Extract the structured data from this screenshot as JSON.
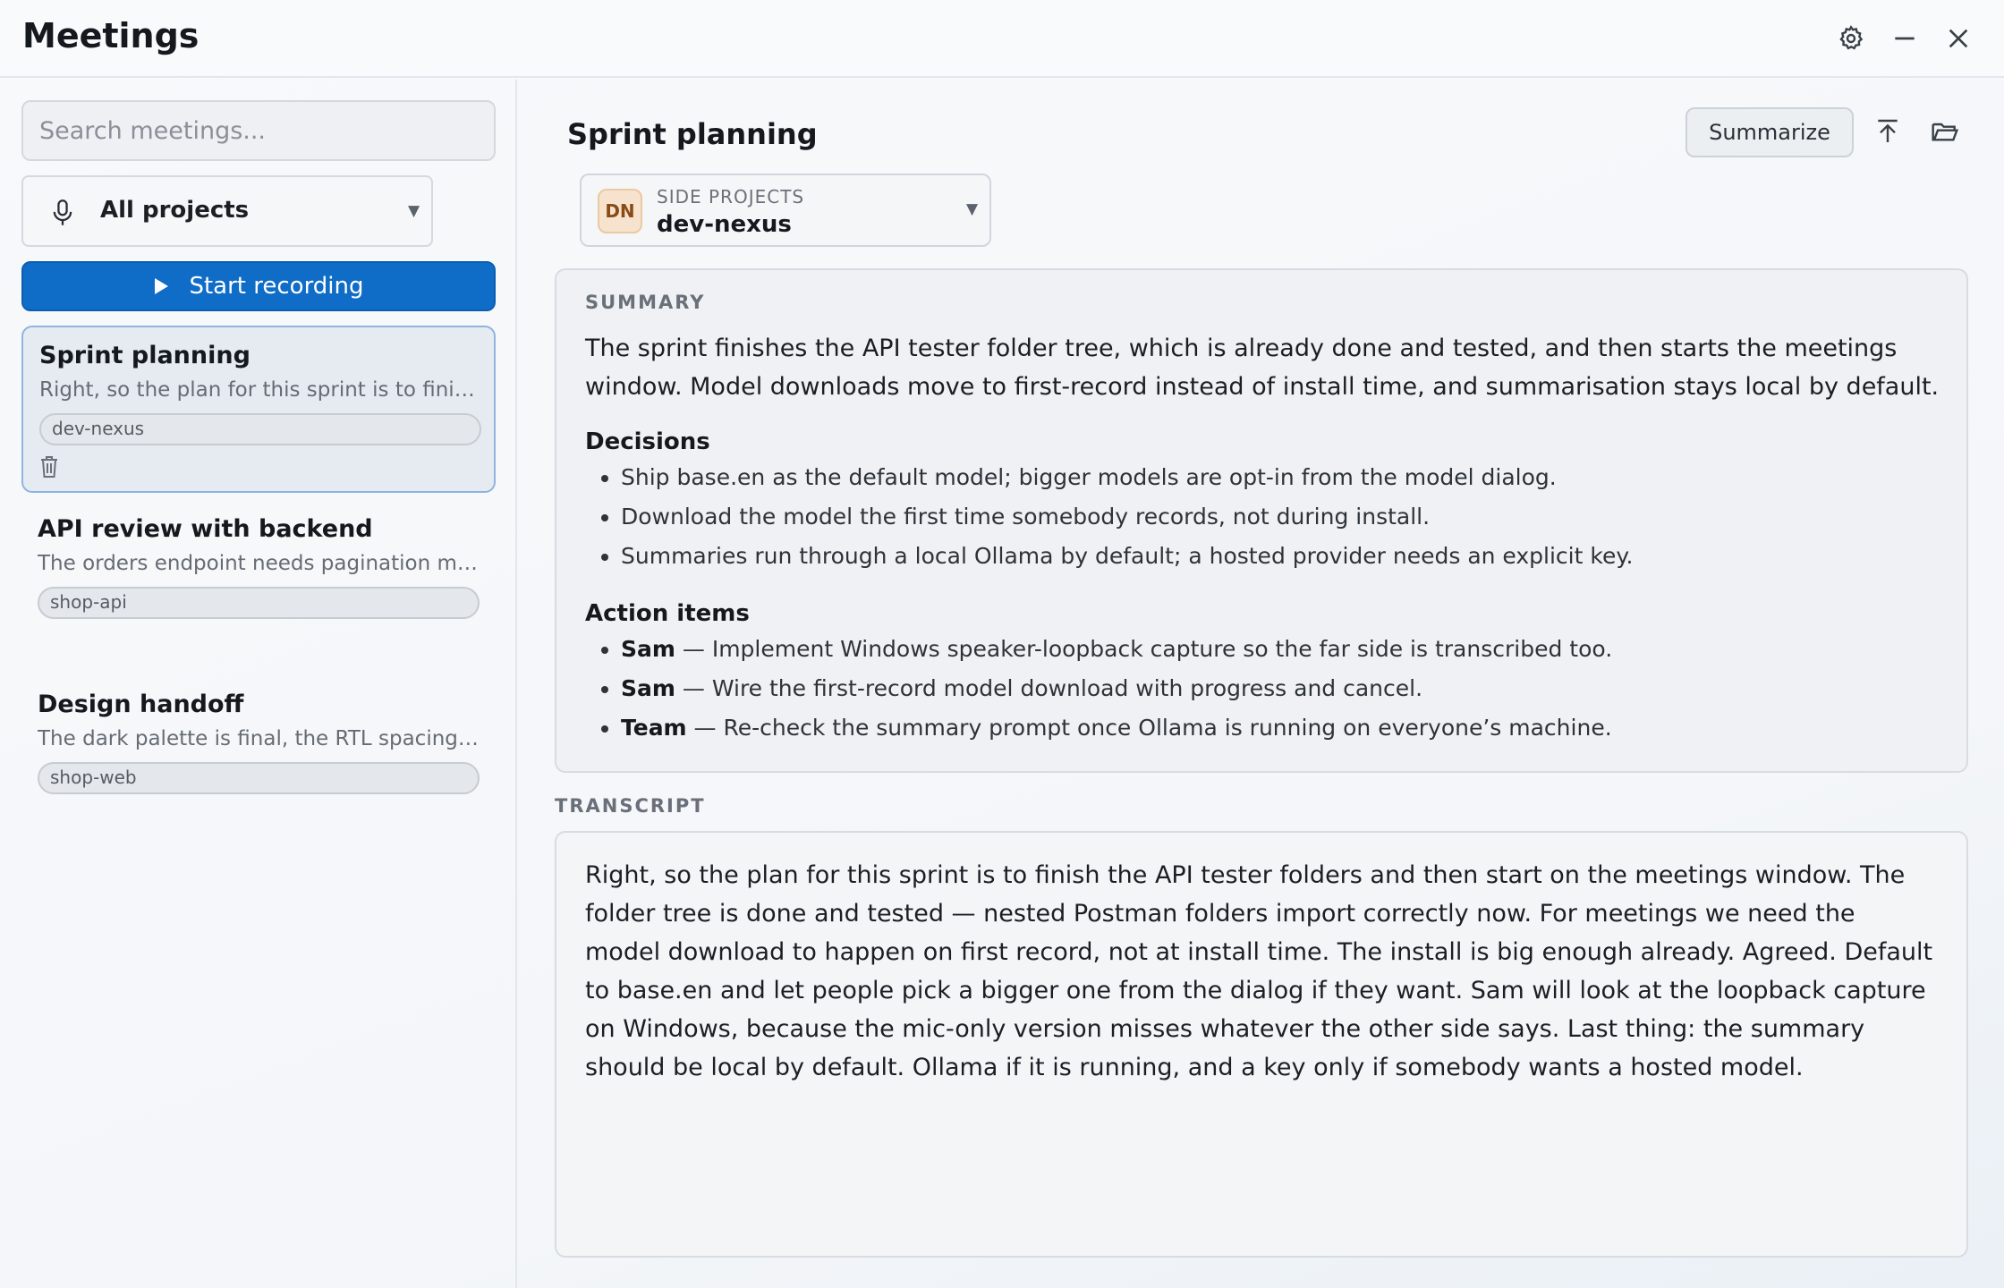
{
  "app": {
    "title": "Meetings"
  },
  "window_controls": [
    "gear-icon",
    "minimize-icon",
    "close-icon"
  ],
  "sidebar": {
    "search_placeholder": "Search meetings...",
    "project_filter": {
      "icon": "microphone-icon",
      "value": "All projects"
    },
    "record_button": {
      "icon": "play-icon",
      "label": "Start recording"
    },
    "meetings": [
      {
        "title": "Sprint planning",
        "snippet": "Right, so the plan for this sprint is to finish...",
        "tag": "dev-nexus",
        "selected": true
      },
      {
        "title": "API review with backend",
        "snippet": "The orders endpoint needs pagination met...",
        "tag": "shop-api",
        "selected": false
      },
      {
        "title": "Design handoff",
        "snippet": "The dark palette is final, the RTL spacing s...",
        "tag": "shop-web",
        "selected": false
      }
    ]
  },
  "main": {
    "title": "Sprint planning",
    "summarize_label": "Summarize",
    "project": {
      "initials": "DN",
      "group": "SIDE PROJECTS",
      "name": "dev-nexus"
    },
    "summary": {
      "label": "SUMMARY",
      "text": "The sprint finishes the API tester folder tree, which is already done and tested, and then starts the meetings window. Model downloads move to first-record instead of install time, and summarisation stays local by default.",
      "decisions_label": "Decisions",
      "decisions": [
        "Ship base.en as the default model; bigger models are opt-in from the model dialog.",
        "Download the model the first time somebody records, not during install.",
        "Summaries run through a local Ollama by default; a hosted provider needs an explicit key."
      ],
      "actions_label": "Action items",
      "actions": [
        {
          "who": "Sam",
          "what": " — Implement Windows speaker-loopback capture so the far side is transcribed too."
        },
        {
          "who": "Sam",
          "what": " — Wire the first-record model download with progress and cancel."
        },
        {
          "who": "Team",
          "what": " — Re-check the summary prompt once Ollama is running on everyone’s machine."
        }
      ]
    },
    "transcript": {
      "label": "TRANSCRIPT",
      "text": "Right, so the plan for this sprint is to finish the API tester folders and then start on the meetings window. The folder tree is done and tested — nested Postman folders import correctly now. For meetings we need the model download to happen on first record, not at install time. The install is big enough already. Agreed. Default to base.en and let people pick a bigger one from the dialog if they want. Sam will look at the loopback capture on Windows, because the mic-only version misses whatever the other side says. Last thing: the summary should be local by default. Ollama if it is running, and a key only if somebody wants a hosted model."
    }
  },
  "colors": {
    "accent": "#0f6cc7",
    "selected_border": "#8fb4e2",
    "avatar_bg": "#f7e3cd"
  }
}
